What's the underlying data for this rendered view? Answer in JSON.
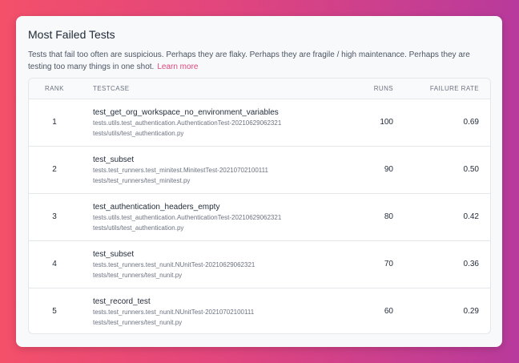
{
  "card": {
    "title": "Most Failed Tests",
    "description": "Tests that fail too often are suspicious. Perhaps they are flaky. Perhaps they are fragile / high maintenance. Perhaps they are testing too many things in one shot.",
    "learn_more": "Learn more"
  },
  "table": {
    "headers": {
      "rank": "RANK",
      "testcase": "TESTCASE",
      "runs": "RUNS",
      "failure_rate": "FAILURE RATE"
    },
    "rows": [
      {
        "rank": "1",
        "name": "test_get_org_workspace_no_environment_variables",
        "class": "tests.utils.test_authentication.AuthenticationTest-20210629062321",
        "file": "tests/utils/test_authentication.py",
        "runs": "100",
        "failure_rate": "0.69"
      },
      {
        "rank": "2",
        "name": "test_subset",
        "class": "tests.test_runners.test_minitest.MinitestTest-20210702100111",
        "file": "tests/test_runners/test_minitest.py",
        "runs": "90",
        "failure_rate": "0.50"
      },
      {
        "rank": "3",
        "name": "test_authentication_headers_empty",
        "class": "tests.utils.test_authentication.AuthenticationTest-20210629062321",
        "file": "tests/utils/test_authentication.py",
        "runs": "80",
        "failure_rate": "0.42"
      },
      {
        "rank": "4",
        "name": "test_subset",
        "class": "tests.test_runners.test_nunit.NUnitTest-20210629062321",
        "file": "tests/test_runners/test_nunit.py",
        "runs": "70",
        "failure_rate": "0.36"
      },
      {
        "rank": "5",
        "name": "test_record_test",
        "class": "tests.test_runners.test_nunit.NUnitTest-20210702100111",
        "file": "tests/test_runners/test_nunit.py",
        "runs": "60",
        "failure_rate": "0.29"
      }
    ]
  }
}
